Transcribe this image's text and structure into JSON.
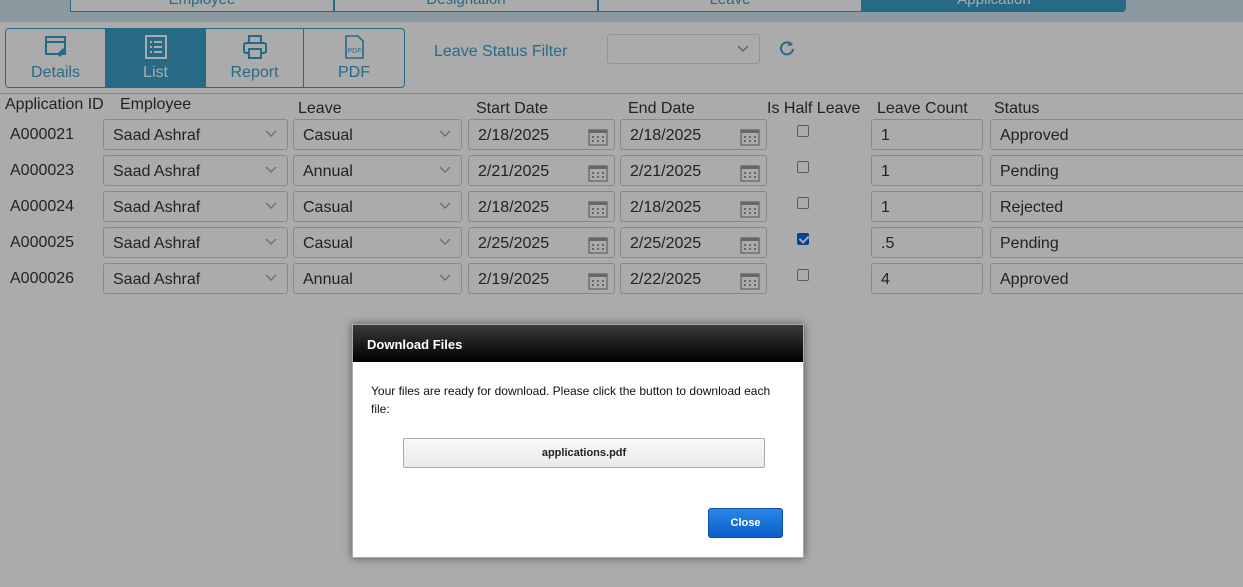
{
  "tabs": [
    "Employee",
    "Designation",
    "Leave",
    "Application"
  ],
  "toolbar": {
    "details": "Details",
    "list": "List",
    "report": "Report",
    "pdf": "PDF"
  },
  "filter": {
    "label": "Leave Status Filter",
    "value": ""
  },
  "columns": {
    "id": "Application ID",
    "employee": "Employee",
    "leave": "Leave",
    "start": "Start Date",
    "end": "End Date",
    "half": "Is Half Leave",
    "count": "Leave Count",
    "status": "Status"
  },
  "rows": [
    {
      "id": "A000021",
      "employee": "Saad Ashraf",
      "leave": "Casual",
      "start": "2/18/2025",
      "end": "2/18/2025",
      "half": false,
      "count": "1",
      "status": "Approved"
    },
    {
      "id": "A000023",
      "employee": "Saad Ashraf",
      "leave": "Annual",
      "start": "2/21/2025",
      "end": "2/21/2025",
      "half": false,
      "count": "1",
      "status": "Pending"
    },
    {
      "id": "A000024",
      "employee": "Saad Ashraf",
      "leave": "Casual",
      "start": "2/18/2025",
      "end": "2/18/2025",
      "half": false,
      "count": "1",
      "status": "Rejected"
    },
    {
      "id": "A000025",
      "employee": "Saad Ashraf",
      "leave": "Casual",
      "start": "2/25/2025",
      "end": "2/25/2025",
      "half": true,
      "count": ".5",
      "status": "Pending"
    },
    {
      "id": "A000026",
      "employee": "Saad Ashraf",
      "leave": "Annual",
      "start": "2/19/2025",
      "end": "2/22/2025",
      "half": false,
      "count": "4",
      "status": "Approved"
    }
  ],
  "dialog": {
    "title": "Download Files",
    "message": "Your files are ready for download. Please click the button to download each file:",
    "file": "applications.pdf",
    "close": "Close"
  },
  "colors": {
    "accent": "#3a9fc8",
    "dialogButton": "#0a64d8"
  }
}
